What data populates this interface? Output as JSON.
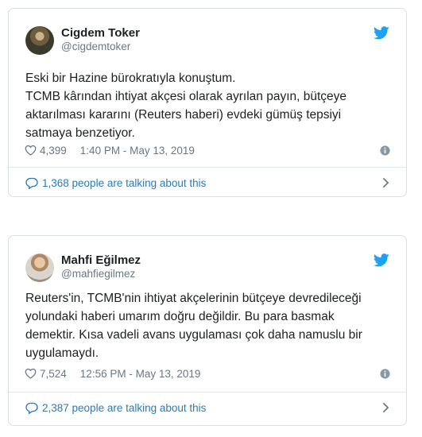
{
  "tweets": [
    {
      "name": "Cigdem Toker",
      "handle": "@cigdemtoker",
      "lines": [
        "Eski bir Hazine bürokratıyla konuştum.",
        "TCMB kârından ihtiyat akçesi olarak ayrılan payın, bütçeye",
        "aktarılması kararını  (Reuters haberi) evdeki gümüş tepsiyi",
        "satmaya benzetiyor."
      ],
      "likes": "4,399",
      "timestamp": "1:40 PM - May 13, 2019",
      "talking": "1,368 people are talking about this"
    },
    {
      "name": "Mahfi Eğilmez",
      "handle": "@mahfiegilmez",
      "lines": [
        "Reuters'in, TCMB'nin ihtiyat akçelerinin bütçeye devredileceği",
        "yolundaki haberi umarım doğru değildir. Bu para basmak",
        "demektir. Kısa vadeli avans uygulaması çok daha namuslu bir",
        "uygulamaydı."
      ],
      "likes": "7,524",
      "timestamp": "12:56 PM - May 13, 2019",
      "talking": "2,387 people are talking about this"
    }
  ],
  "icons": {
    "bird": "twitter-bird-icon",
    "heart": "heart-icon",
    "info": "info-icon",
    "comment": "comment-icon",
    "chevron": "chevron-right-icon"
  },
  "colors": {
    "twitter_blue": "#1da1f2",
    "link_blue": "#2b7bb9",
    "muted_gray": "#697882",
    "border": "#d9e0e5"
  }
}
